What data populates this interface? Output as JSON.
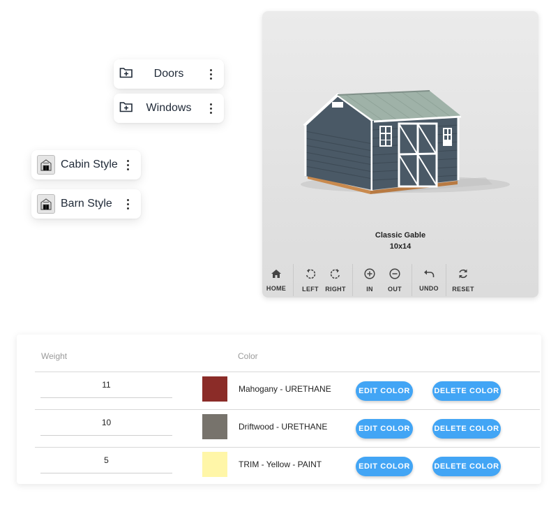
{
  "folders": [
    {
      "label": "Doors"
    },
    {
      "label": "Windows"
    }
  ],
  "styles": [
    {
      "label": "Cabin Style"
    },
    {
      "label": "Barn Style"
    }
  ],
  "viewer": {
    "caption_line1": "Classic Gable",
    "caption_line2": "10x14",
    "toolbar": [
      {
        "icon": "home-icon",
        "label": "HOME"
      },
      {
        "icon": "rotate-left-icon",
        "label": "LEFT"
      },
      {
        "icon": "rotate-right-icon",
        "label": "RIGHT"
      },
      {
        "icon": "zoom-in-icon",
        "label": "IN"
      },
      {
        "icon": "zoom-out-icon",
        "label": "OUT"
      },
      {
        "icon": "undo-icon",
        "label": "UNDO"
      },
      {
        "icon": "reset-icon",
        "label": "RESET"
      }
    ]
  },
  "table": {
    "headers": {
      "weight": "Weight",
      "color": "Color"
    },
    "edit_label": "EDIT COLOR",
    "delete_label": "DELETE COLOR",
    "rows": [
      {
        "weight": "11",
        "color_name": "Mahogany - URETHANE",
        "swatch": "#8b2c28"
      },
      {
        "weight": "10",
        "color_name": "Driftwood - URETHANE",
        "swatch": "#77736c"
      },
      {
        "weight": "5",
        "color_name": "TRIM - Yellow - PAINT",
        "swatch": "#fff6a8"
      }
    ]
  },
  "colors": {
    "accent": "#42a5f5",
    "siding": "#4a5966",
    "roof": "#9fb2a8",
    "trim": "#ffffff"
  }
}
